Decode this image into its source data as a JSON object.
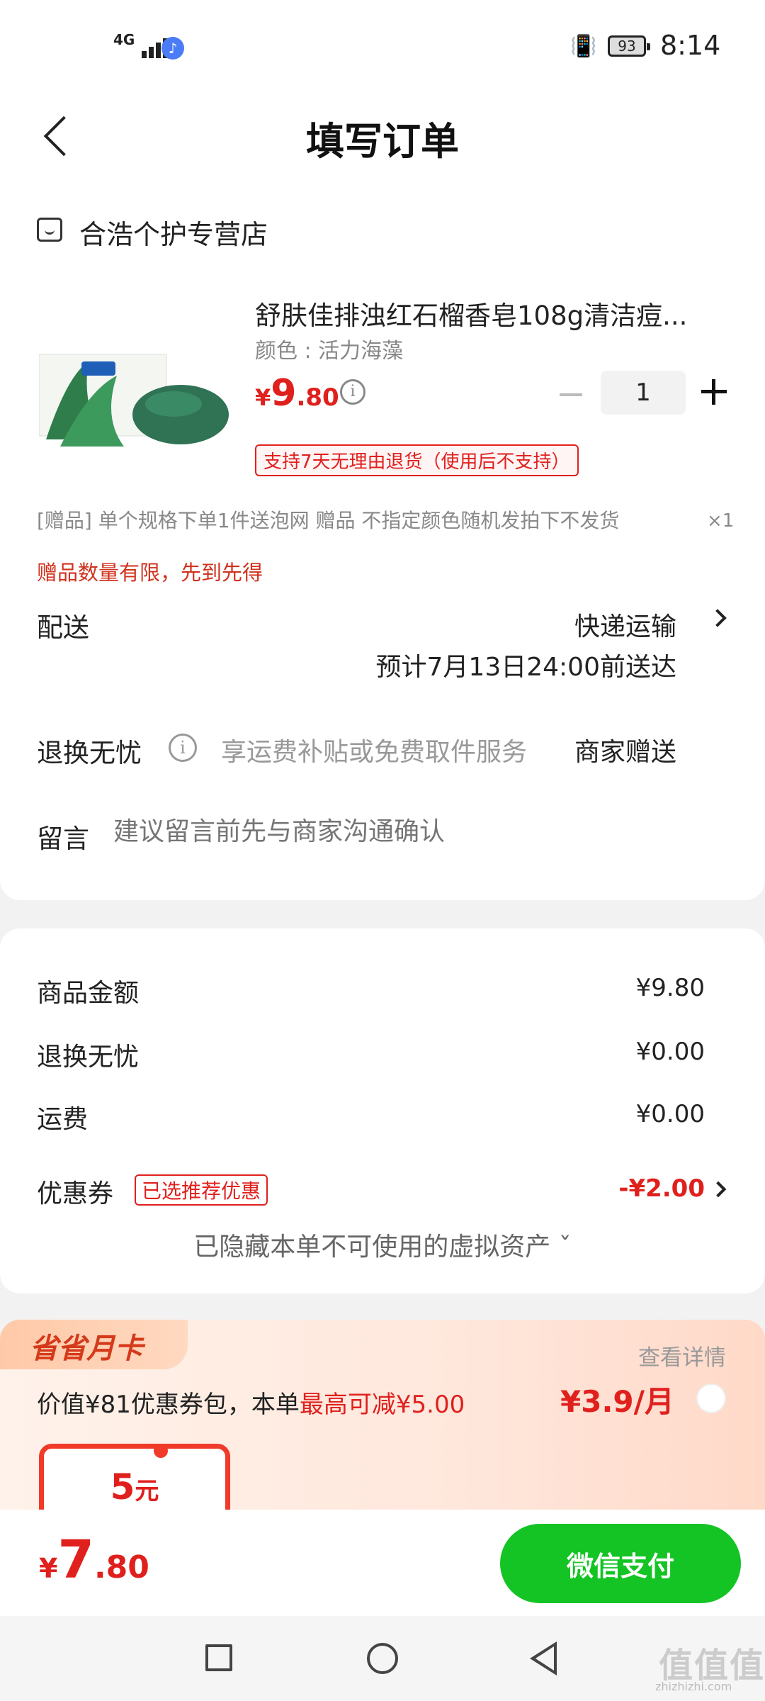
{
  "status_bar": {
    "network": "4G",
    "battery": "93",
    "time": "8:14"
  },
  "header": {
    "title": "填写订单"
  },
  "shop": {
    "name": "合浩个护专营店"
  },
  "product": {
    "title": "舒肤佳排浊红石榴香皂108g清洁痘...",
    "spec": "颜色 : 活力海藻",
    "price_currency": "¥",
    "price_int": "9",
    "price_dec": ".80",
    "quantity": "1",
    "refund_badge": "支持7天无理由退货（使用后不支持）"
  },
  "gift": {
    "line": "[赠品]   单个规格下单1件送泡网 赠品 不指定颜色随机发拍下不发货",
    "qty": "×1",
    "note": "赠品数量有限，先到先得"
  },
  "delivery": {
    "label": "配送",
    "method": "快递运输",
    "eta": "预计7月13日24:00前送达"
  },
  "returns": {
    "label": "退换无忧",
    "desc": "享运费补贴或免费取件服务",
    "value": "商家赠送"
  },
  "message": {
    "label": "留言",
    "placeholder": "建议留言前先与商家沟通确认"
  },
  "summary": {
    "goods_label": "商品金额",
    "goods_value": "¥9.80",
    "returns_label": "退换无忧",
    "returns_value": "¥0.00",
    "shipping_label": "运费",
    "shipping_value": "¥0.00",
    "coupon_label": "优惠券",
    "coupon_badge": "已选推荐优惠",
    "coupon_value": "-¥2.00",
    "hidden_assets": "已隐藏本单不可使用的虚拟资产 ˇ"
  },
  "promo": {
    "tag": "省省月卡",
    "detail_link": "查看详情",
    "desc_prefix": "价值¥81优惠券包，本单",
    "desc_highlight": "最高可减¥5.00",
    "price": "¥3.9/月",
    "voucher_amount": "5",
    "voucher_unit": "元"
  },
  "bottom": {
    "total_currency": "¥",
    "total_int": "7",
    "total_dec": ".80",
    "pay_button": "微信支付"
  },
  "watermark": {
    "text": "值值值",
    "sub": "zhizhizhi.com"
  },
  "colors": {
    "accent_red": "#e0201d",
    "pay_green": "#14c424"
  }
}
